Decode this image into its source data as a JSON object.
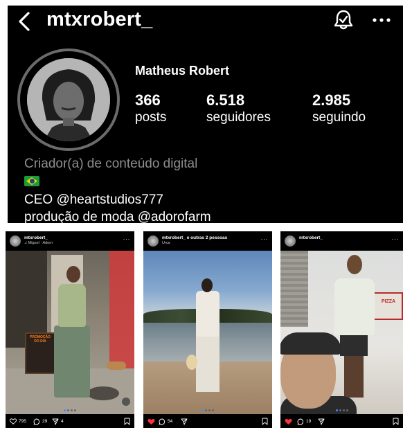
{
  "profile": {
    "username": "mtxrobert_",
    "full_name": "Matheus Robert",
    "stats": {
      "posts": {
        "value": "366",
        "label": "posts"
      },
      "followers": {
        "value": "6.518",
        "label": "seguidores"
      },
      "following": {
        "value": "2.985",
        "label": "seguindo"
      }
    },
    "bio": {
      "category": "Criador(a) de conteúdo digital",
      "flag": "brazil-flag-icon",
      "line1": "CEO @heartstudios777",
      "line2": "produção de moda @adorofarm"
    },
    "icons": [
      "back-arrow-icon",
      "notification-bell-icon",
      "more-options-icon"
    ]
  },
  "posts": [
    {
      "user": "mtxrobert_",
      "subtitle": "♫ Miguel · Adorn",
      "board_text": "PROMOÇÃO DO DIA",
      "likes": "795",
      "comments": "29",
      "shares": "4",
      "liked": false
    },
    {
      "user": "mtxrobert_ e outras 2 pessoas",
      "subtitle": "Urca",
      "comments": "54",
      "liked": true
    },
    {
      "user": "mtxrobert_",
      "sign_text": "PIZZA",
      "comments": "19",
      "liked": true
    }
  ],
  "colors": {
    "background": "#000000",
    "text": "#ffffff",
    "muted": "#8e8e8e",
    "like_red": "#ff3040",
    "dot_active": "#3a8dff"
  }
}
